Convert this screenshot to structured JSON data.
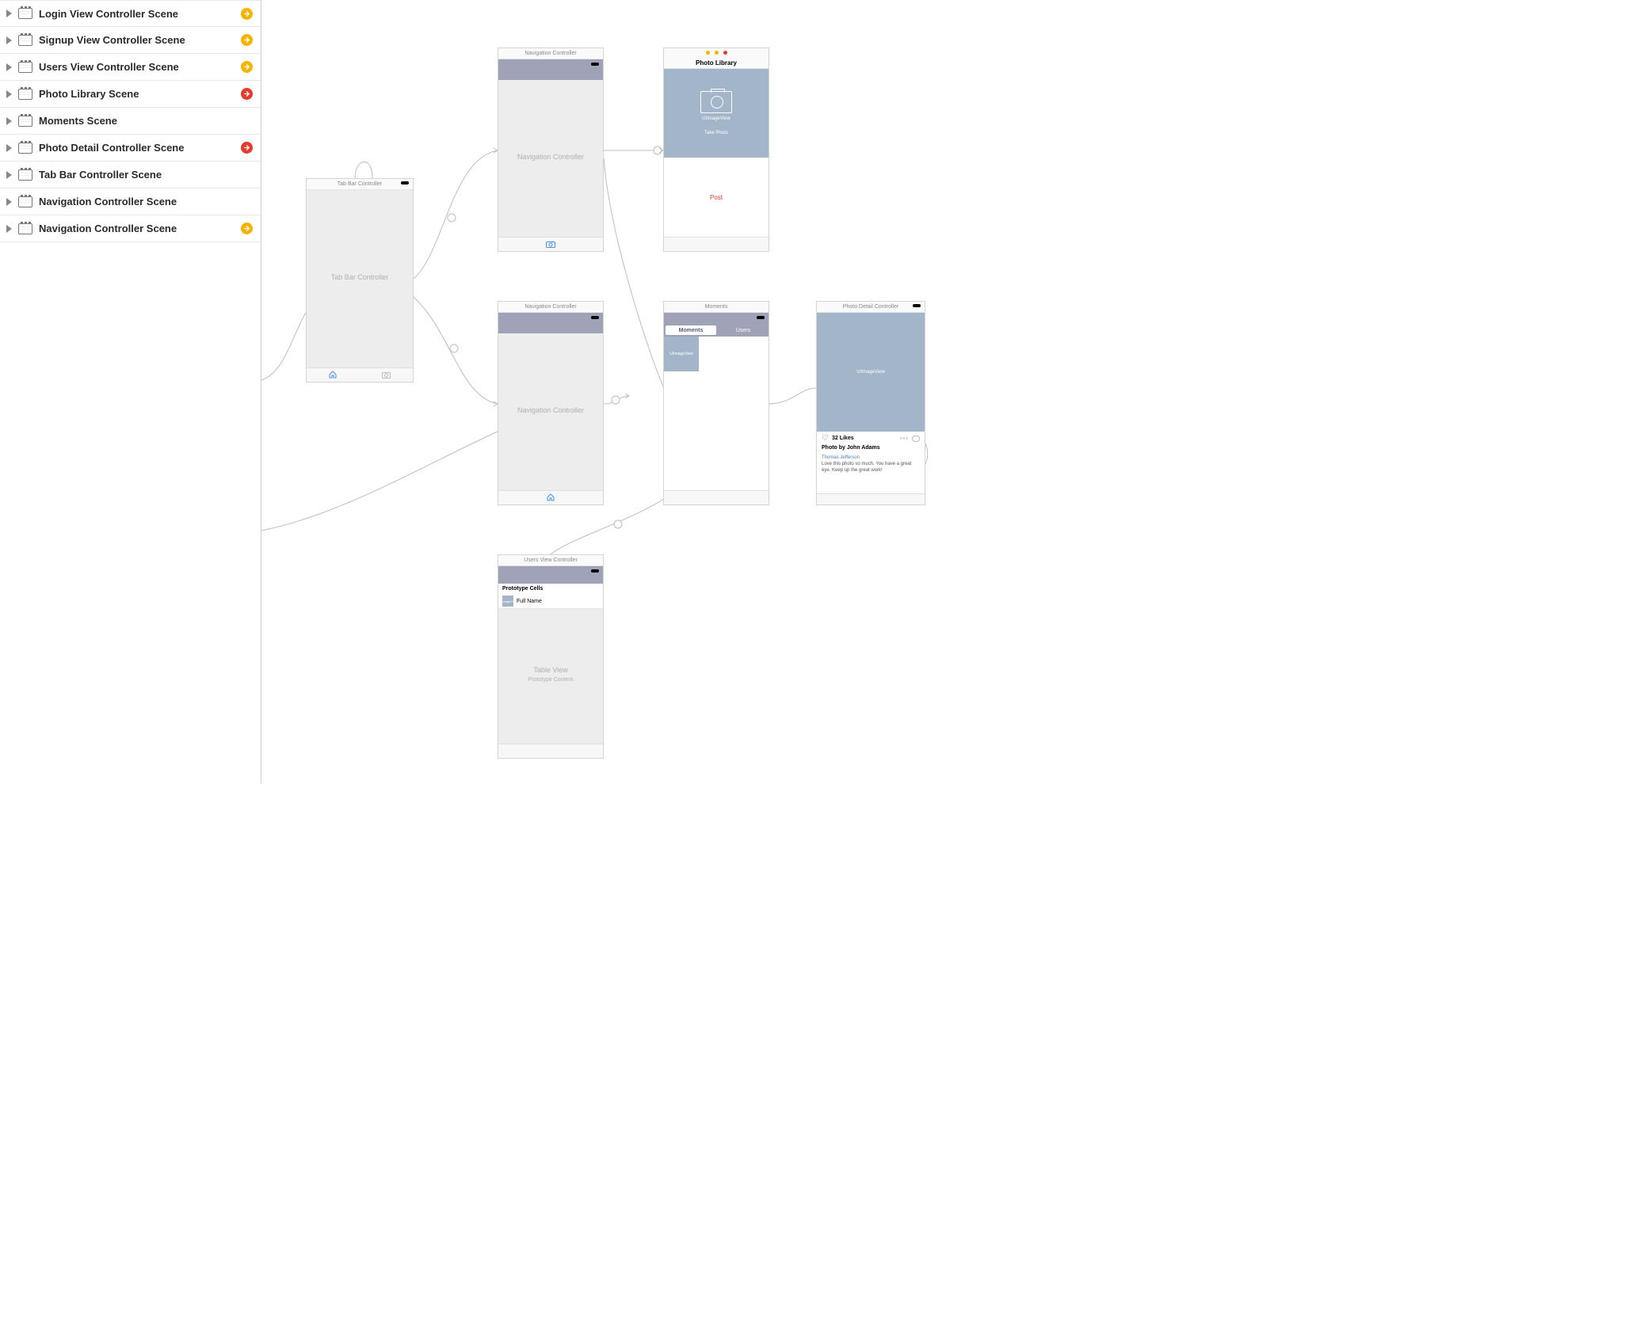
{
  "sidebar": {
    "scenes": [
      {
        "label": "Login View Controller Scene",
        "badge": "yellow"
      },
      {
        "label": "Signup View Controller Scene",
        "badge": "yellow"
      },
      {
        "label": "Users View Controller Scene",
        "badge": "yellow"
      },
      {
        "label": "Photo Library Scene",
        "badge": "red"
      },
      {
        "label": "Moments Scene",
        "badge": null
      },
      {
        "label": "Photo Detail Controller Scene",
        "badge": "red"
      },
      {
        "label": "Tab Bar Controller Scene",
        "badge": null
      },
      {
        "label": "Navigation Controller Scene",
        "badge": null
      },
      {
        "label": "Navigation Controller Scene",
        "badge": "yellow"
      }
    ]
  },
  "canvas": {
    "tabbar": {
      "title": "Tab Bar Controller",
      "body": "Tab Bar Controller"
    },
    "nav1": {
      "title": "Navigation Controller",
      "body": "Navigation Controller"
    },
    "nav2": {
      "title": "Navigation Controller",
      "body": "Navigation Controller"
    },
    "photolib": {
      "title": "Photo Library",
      "imglabel": "UIImageView",
      "takephoto": "Take Photo",
      "post": "Post"
    },
    "moments": {
      "title": "Moments",
      "seg_moments": "Moments",
      "seg_users": "Users",
      "thumb": "UIImageView"
    },
    "photodetail": {
      "title": "Photo Detail Controller",
      "imglabel": "UIImageView",
      "likes": "32 Likes",
      "caption": "Photo by John Adams",
      "author": "Thomas Jefferson",
      "comment": "Love this photo so much. You have a great eye. Keep up the great work!"
    },
    "users": {
      "title": "Users View Controller",
      "proto_hdr": "Prototype Cells",
      "thumb": "UIImageView",
      "cell": "Full Name",
      "tv": "Table View",
      "pc": "Prototype Content"
    }
  }
}
